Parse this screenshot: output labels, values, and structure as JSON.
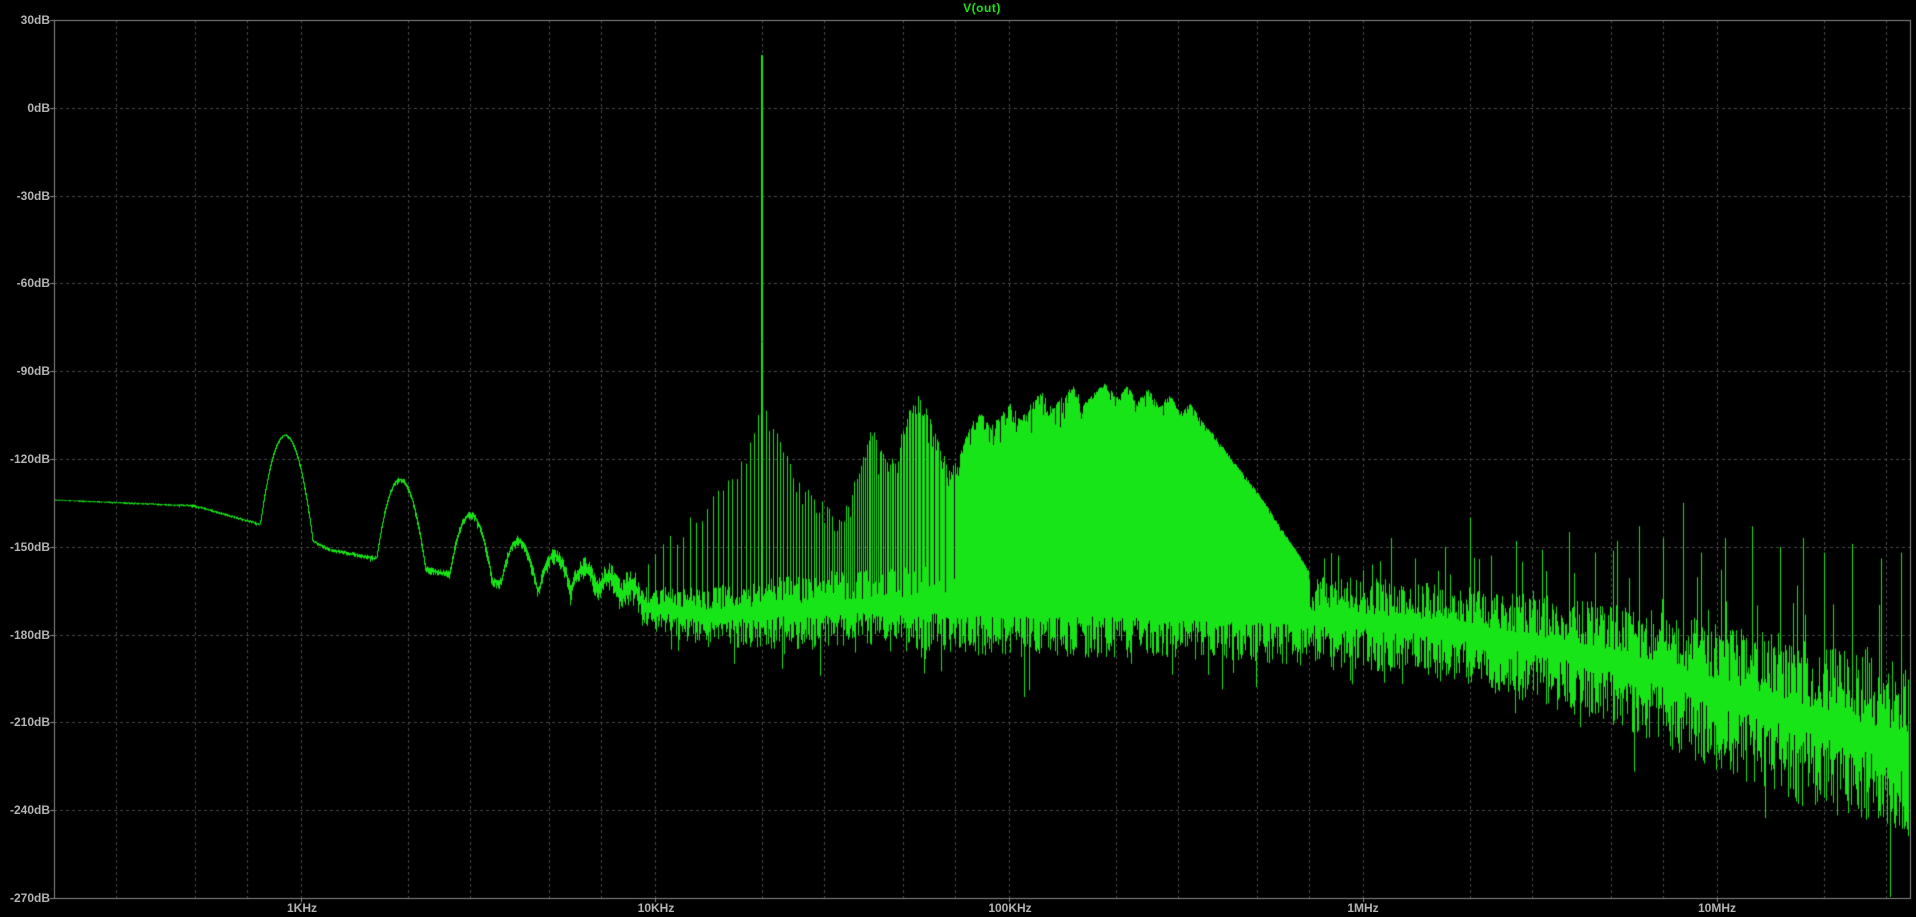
{
  "colors": {
    "background": "#000000",
    "trace": "#17e517",
    "grid": "#474747",
    "border": "#8a8a8a",
    "text": "#b4b4b4"
  },
  "chart_data": {
    "type": "line",
    "title": "V(out)",
    "seed": 1337,
    "x_axis": {
      "scale": "log",
      "unit": "Hz",
      "min_hz": 200,
      "max_hz": 35000000,
      "tick_labels": [
        "1KHz",
        "10KHz",
        "100KHz",
        "1MHz",
        "10MHz"
      ],
      "tick_values_hz": [
        1000,
        10000,
        100000,
        1000000,
        10000000
      ],
      "minor_tick_multipliers": [
        2,
        3,
        5,
        7
      ]
    },
    "y_axis": {
      "unit": "dB",
      "min": -270,
      "max": 30,
      "step": 30,
      "tick_labels": [
        "30dB",
        "0dB",
        "-30dB",
        "-60dB",
        "-90dB",
        "-120dB",
        "-150dB",
        "-180dB",
        "-210dB",
        "-240dB",
        "-270dB"
      ]
    },
    "series": [
      {
        "name": "V(out)",
        "color": "#17e517"
      }
    ],
    "fundamental": {
      "freq_hz": 20000,
      "level_db": 18
    },
    "noise_floor_center_db": [
      [
        200,
        -134
      ],
      [
        500,
        -136
      ],
      [
        800,
        -143
      ],
      [
        1000,
        -146
      ],
      [
        1200,
        -151
      ],
      [
        1800,
        -155
      ],
      [
        2500,
        -159
      ],
      [
        3500,
        -162
      ],
      [
        5000,
        -165
      ],
      [
        6500,
        -167
      ],
      [
        8000,
        -169
      ],
      [
        10000,
        -171
      ],
      [
        14000,
        -173
      ],
      [
        20000,
        -172
      ],
      [
        35000,
        -170
      ],
      [
        60000,
        -170
      ],
      [
        100000,
        -171
      ],
      [
        200000,
        -171
      ],
      [
        400000,
        -172
      ],
      [
        700000,
        -174
      ],
      [
        1000000,
        -175
      ],
      [
        1500000,
        -177
      ],
      [
        2200000,
        -180
      ],
      [
        3000000,
        -183
      ],
      [
        4500000,
        -187
      ],
      [
        6000000,
        -191
      ],
      [
        8000000,
        -195
      ],
      [
        10000000,
        -199
      ],
      [
        14000000,
        -204
      ],
      [
        20000000,
        -210
      ],
      [
        27000000,
        -215
      ],
      [
        35000000,
        -219
      ]
    ],
    "noise_spread_db": [
      [
        200,
        0.25
      ],
      [
        700,
        0.5
      ],
      [
        1500,
        0.8
      ],
      [
        3000,
        1.5
      ],
      [
        5000,
        2.5
      ],
      [
        7000,
        4
      ],
      [
        9000,
        6.5
      ],
      [
        12000,
        8.5
      ],
      [
        20000,
        11
      ],
      [
        40000,
        13
      ],
      [
        100000,
        14
      ],
      [
        300000,
        14
      ],
      [
        700000,
        14
      ],
      [
        1500000,
        15
      ],
      [
        3000000,
        17
      ],
      [
        6000000,
        20
      ],
      [
        10000000,
        23
      ],
      [
        18000000,
        26
      ],
      [
        35000000,
        29
      ]
    ],
    "low_freq_bumps": [
      [
        900,
        -112
      ],
      [
        1900,
        -127
      ],
      [
        3000,
        -139
      ],
      [
        4100,
        -148
      ],
      [
        5200,
        -153
      ],
      [
        6300,
        -157
      ],
      [
        7400,
        -160
      ],
      [
        8500,
        -163
      ]
    ],
    "comb": {
      "spacing_hz": 500,
      "start_hz": 9000,
      "end_hz": 700000,
      "jitter_db": 12,
      "tip_envelope_db": [
        [
          9000,
          -163
        ],
        [
          10000,
          -153
        ],
        [
          11000,
          -148
        ],
        [
          12000,
          -144
        ],
        [
          13500,
          -138
        ],
        [
          15000,
          -132
        ],
        [
          16500,
          -127
        ],
        [
          18000,
          -119
        ],
        [
          19000,
          -110
        ],
        [
          19800,
          -100
        ],
        [
          20200,
          -100
        ],
        [
          21000,
          -107
        ],
        [
          22500,
          -116
        ],
        [
          24000,
          -122
        ],
        [
          26000,
          -128
        ],
        [
          28500,
          -134
        ],
        [
          31000,
          -139
        ],
        [
          33500,
          -142
        ],
        [
          36000,
          -132
        ],
        [
          39000,
          -118
        ],
        [
          41000,
          -111
        ],
        [
          43500,
          -119
        ],
        [
          46000,
          -123
        ],
        [
          49000,
          -115
        ],
        [
          52000,
          -105
        ],
        [
          55000,
          -100
        ],
        [
          58000,
          -104
        ],
        [
          61000,
          -112
        ],
        [
          65000,
          -120
        ],
        [
          69000,
          -125
        ],
        [
          73000,
          -118
        ],
        [
          78000,
          -110
        ],
        [
          83000,
          -105
        ],
        [
          88000,
          -111
        ],
        [
          94000,
          -107
        ],
        [
          100000,
          -102
        ],
        [
          107000,
          -108
        ],
        [
          115000,
          -103
        ],
        [
          123000,
          -99
        ],
        [
          132000,
          -105
        ],
        [
          141000,
          -100
        ],
        [
          151000,
          -97
        ],
        [
          162000,
          -103
        ],
        [
          174000,
          -99
        ],
        [
          186000,
          -96
        ],
        [
          200000,
          -101
        ],
        [
          214000,
          -97
        ],
        [
          230000,
          -102
        ],
        [
          246000,
          -98
        ],
        [
          264000,
          -104
        ],
        [
          283000,
          -100
        ],
        [
          303000,
          -106
        ],
        [
          325000,
          -103
        ],
        [
          349000,
          -109
        ],
        [
          374000,
          -113
        ],
        [
          401000,
          -118
        ],
        [
          430000,
          -123
        ],
        [
          470000,
          -129
        ],
        [
          520000,
          -136
        ],
        [
          580000,
          -145
        ],
        [
          650000,
          -154
        ],
        [
          700000,
          -160
        ]
      ]
    },
    "isolated_spikes": [
      [
        850000,
        -153
      ],
      [
        1000000,
        -158
      ],
      [
        1200000,
        -147
      ],
      [
        1400000,
        -154
      ],
      [
        1700000,
        -150
      ],
      [
        2000000,
        -140
      ],
      [
        2300000,
        -153
      ],
      [
        2700000,
        -148
      ],
      [
        3200000,
        -151
      ],
      [
        3800000,
        -145
      ],
      [
        4500000,
        -152
      ],
      [
        5200000,
        -148
      ],
      [
        6000000,
        -143
      ],
      [
        7000000,
        -147
      ],
      [
        8000000,
        -135
      ],
      [
        9000000,
        -152
      ],
      [
        10500000,
        -147
      ],
      [
        12500000,
        -143
      ],
      [
        15000000,
        -150
      ],
      [
        17500000,
        -147
      ],
      [
        20000000,
        -152
      ],
      [
        24000000,
        -149
      ],
      [
        29000000,
        -154
      ],
      [
        33000000,
        -152
      ]
    ]
  }
}
